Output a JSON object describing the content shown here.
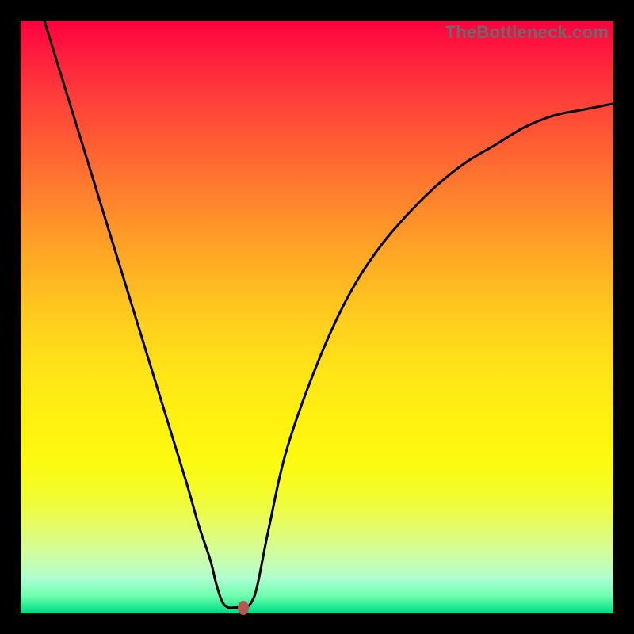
{
  "watermark": "TheBottleneck.com",
  "chart_data": {
    "type": "line",
    "title": "",
    "xlabel": "",
    "ylabel": "",
    "xlim": [
      0,
      100
    ],
    "ylim": [
      0,
      100
    ],
    "grid": false,
    "legend": false,
    "annotations": [],
    "series": [
      {
        "name": "curve",
        "color": "#000000",
        "x": [
          4,
          8,
          12,
          16,
          20,
          24,
          28,
          30,
          32,
          33,
          34,
          35,
          36,
          37,
          38,
          39,
          40,
          42,
          45,
          50,
          55,
          60,
          65,
          70,
          75,
          80,
          85,
          90,
          95,
          100
        ],
        "y": [
          100,
          87,
          74,
          61,
          48,
          35,
          22,
          15,
          9,
          5,
          2,
          1,
          1,
          1,
          1,
          2,
          5,
          15,
          28,
          42,
          53,
          61,
          67,
          72,
          76,
          79,
          82,
          84,
          85,
          86
        ]
      }
    ],
    "marker": {
      "x": 37.5,
      "y": 1,
      "color": "#b9564f"
    }
  }
}
